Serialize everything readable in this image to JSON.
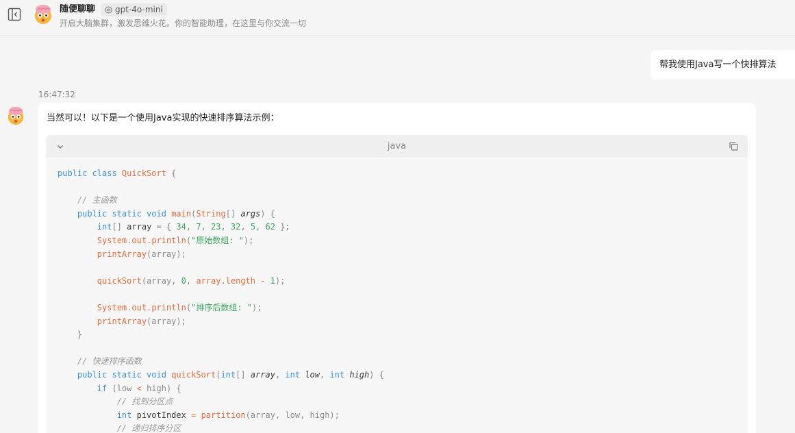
{
  "header": {
    "title": "随便聊聊",
    "model_badge": "gpt-4o-mini",
    "subtitle": "开启大脑集群，激发思维火花。你的智能助理，在这里与你交流一切"
  },
  "icons": {
    "sidebar_toggle": "sidebar-toggle-icon",
    "avatar": "brain-avatar-icon",
    "model": "model-icon",
    "collapse": "chevron-down-icon",
    "copy": "copy-icon"
  },
  "colors": {
    "keyword": "#3a8fd8",
    "function": "#e06b3c",
    "string": "#3aa55d",
    "comment": "#9a9a9a",
    "background": "#f5f5f5"
  },
  "messages": {
    "user": {
      "text": "帮我使用Java写一个快排算法"
    },
    "assistant": {
      "timestamp": "16:47:32",
      "intro": "当然可以！以下是一个使用Java实现的快速排序算法示例：",
      "code": {
        "language": "java",
        "lines": [
          [
            [
              "kw",
              "public class "
            ],
            [
              "fn",
              "QuickSort"
            ],
            [
              "pn",
              " {"
            ]
          ],
          [],
          [
            [
              "pn",
              "    "
            ],
            [
              "cm",
              "// 主函数"
            ]
          ],
          [
            [
              "pn",
              "    "
            ],
            [
              "kw",
              "public static void "
            ],
            [
              "fn",
              "main"
            ],
            [
              "pn",
              "("
            ],
            [
              "fn",
              "String"
            ],
            [
              "pn",
              "[] "
            ],
            [
              "it",
              "args"
            ],
            [
              "pn",
              ") {"
            ]
          ],
          [
            [
              "pn",
              "        "
            ],
            [
              "kw",
              "int"
            ],
            [
              "pn",
              "[] "
            ],
            [
              "id",
              "array"
            ],
            [
              "pn",
              " = { "
            ],
            [
              "num",
              "34"
            ],
            [
              "pn",
              ", "
            ],
            [
              "num",
              "7"
            ],
            [
              "pn",
              ", "
            ],
            [
              "num",
              "23"
            ],
            [
              "pn",
              ", "
            ],
            [
              "num",
              "32"
            ],
            [
              "pn",
              ", "
            ],
            [
              "num",
              "5"
            ],
            [
              "pn",
              ", "
            ],
            [
              "num",
              "62"
            ],
            [
              "pn",
              " };"
            ]
          ],
          [
            [
              "pn",
              "        "
            ],
            [
              "fn",
              "System"
            ],
            [
              "pn",
              "."
            ],
            [
              "fn",
              "out"
            ],
            [
              "pn",
              "."
            ],
            [
              "fn",
              "println"
            ],
            [
              "pn",
              "("
            ],
            [
              "str",
              "\"原始数组: \""
            ],
            [
              "pn",
              ");"
            ]
          ],
          [
            [
              "pn",
              "        "
            ],
            [
              "fn",
              "printArray"
            ],
            [
              "pn",
              "(array);"
            ]
          ],
          [],
          [
            [
              "pn",
              "        "
            ],
            [
              "fn",
              "quickSort"
            ],
            [
              "pn",
              "(array, "
            ],
            [
              "num",
              "0"
            ],
            [
              "pn",
              ", "
            ],
            [
              "fn",
              "array"
            ],
            [
              "pn",
              "."
            ],
            [
              "fn",
              "length"
            ],
            [
              "pn",
              " "
            ],
            [
              "op",
              "-"
            ],
            [
              "pn",
              " "
            ],
            [
              "num",
              "1"
            ],
            [
              "pn",
              ");"
            ]
          ],
          [],
          [
            [
              "pn",
              "        "
            ],
            [
              "fn",
              "System"
            ],
            [
              "pn",
              "."
            ],
            [
              "fn",
              "out"
            ],
            [
              "pn",
              "."
            ],
            [
              "fn",
              "println"
            ],
            [
              "pn",
              "("
            ],
            [
              "str",
              "\"排序后数组: \""
            ],
            [
              "pn",
              ");"
            ]
          ],
          [
            [
              "pn",
              "        "
            ],
            [
              "fn",
              "printArray"
            ],
            [
              "pn",
              "(array);"
            ]
          ],
          [
            [
              "pn",
              "    }"
            ]
          ],
          [],
          [
            [
              "pn",
              "    "
            ],
            [
              "cm",
              "// 快速排序函数"
            ]
          ],
          [
            [
              "pn",
              "    "
            ],
            [
              "kw",
              "public static void "
            ],
            [
              "fn",
              "quickSort"
            ],
            [
              "pn",
              "("
            ],
            [
              "kw",
              "int"
            ],
            [
              "pn",
              "[] "
            ],
            [
              "it",
              "array"
            ],
            [
              "pn",
              ", "
            ],
            [
              "kw",
              "int "
            ],
            [
              "it",
              "low"
            ],
            [
              "pn",
              ", "
            ],
            [
              "kw",
              "int "
            ],
            [
              "it",
              "high"
            ],
            [
              "pn",
              ") {"
            ]
          ],
          [
            [
              "pn",
              "        "
            ],
            [
              "kw",
              "if "
            ],
            [
              "pn",
              "(low "
            ],
            [
              "op",
              "<"
            ],
            [
              "pn",
              " high) {"
            ]
          ],
          [
            [
              "pn",
              "            "
            ],
            [
              "cm",
              "// 找到分区点"
            ]
          ],
          [
            [
              "pn",
              "            "
            ],
            [
              "kw",
              "int "
            ],
            [
              "id",
              "pivotIndex"
            ],
            [
              "pn",
              " "
            ],
            [
              "op",
              "="
            ],
            [
              "pn",
              " "
            ],
            [
              "fn",
              "partition"
            ],
            [
              "pn",
              "(array, low, high);"
            ]
          ],
          [
            [
              "pn",
              "            "
            ],
            [
              "cm",
              "// 递归排序分区"
            ]
          ]
        ]
      }
    }
  }
}
